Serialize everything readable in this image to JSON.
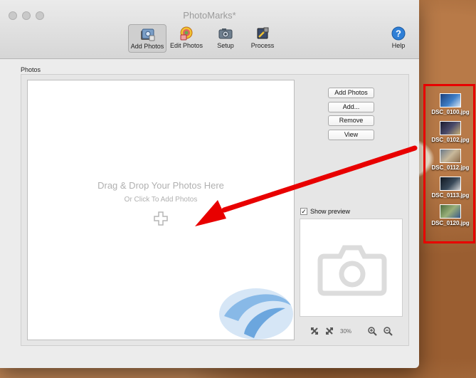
{
  "window": {
    "title": "PhotoMarks*"
  },
  "toolbar": {
    "items": [
      {
        "label": "Add Photos",
        "icon": "add-photos-icon",
        "active": true
      },
      {
        "label": "Edit Photos",
        "icon": "edit-photos-icon",
        "active": false
      },
      {
        "label": "Setup",
        "icon": "setup-icon",
        "active": false
      },
      {
        "label": "Process",
        "icon": "process-icon",
        "active": false
      }
    ],
    "help_label": "Help"
  },
  "photos": {
    "section_label": "Photos",
    "dropzone_title": "Drag & Drop Your Photos Here",
    "dropzone_subtitle": "Or Click To Add Photos"
  },
  "buttons": {
    "add_photos": "Add Photos",
    "add": "Add...",
    "remove": "Remove",
    "view": "View"
  },
  "preview": {
    "show_preview_label": "Show preview",
    "show_preview_checked": true,
    "zoom": "30%"
  },
  "desktop_files": [
    {
      "name": "DSC_0100.jpg"
    },
    {
      "name": "DSC_0102.jpg"
    },
    {
      "name": "DSC_0112.jpg"
    },
    {
      "name": "DSC_0113.jpg"
    },
    {
      "name": "DSC_0120.jpg"
    }
  ],
  "colors": {
    "accent_red": "#e80000",
    "help_blue": "#2f7fd6"
  }
}
